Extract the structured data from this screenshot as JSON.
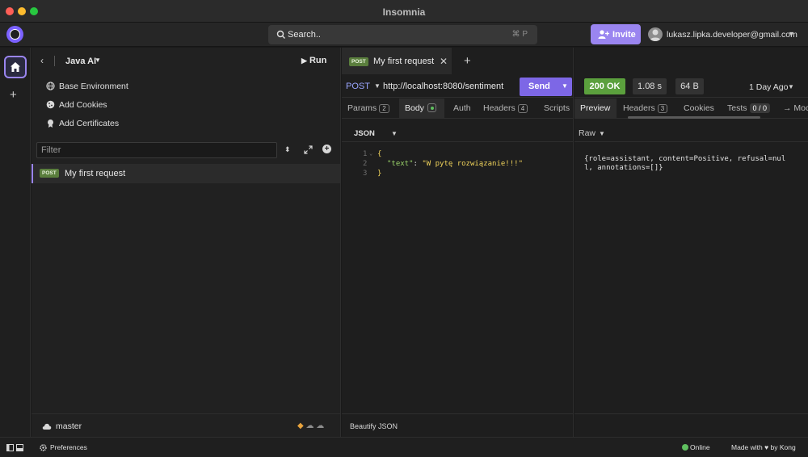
{
  "window": {
    "title": "Insomnia"
  },
  "topbar": {
    "search_label": "Search..",
    "search_shortcut": "⌘ P",
    "invite_label": "Invite",
    "account_email": "lukasz.lipka.developer@gmail.com"
  },
  "sidebar": {
    "project_name": "Java AI",
    "run_label": "Run",
    "items": [
      {
        "label": "Base Environment",
        "icon": "globe-icon"
      },
      {
        "label": "Add Cookies",
        "icon": "cookie-icon"
      },
      {
        "label": "Add Certificates",
        "icon": "certificate-icon"
      }
    ],
    "filter_placeholder": "Filter",
    "request": {
      "method": "POST",
      "name": "My first request"
    },
    "branch": "master"
  },
  "request": {
    "tab_method": "POST",
    "tab_name": "My first request",
    "method": "POST",
    "url": "http://localhost:8080/sentiment",
    "send_label": "Send",
    "tabs": [
      {
        "label": "Params",
        "count": "2"
      },
      {
        "label": "Body"
      },
      {
        "label": "Auth"
      },
      {
        "label": "Headers",
        "count": "4"
      },
      {
        "label": "Scripts"
      }
    ],
    "body_mode": "JSON",
    "code": {
      "line_numbers": [
        "1",
        "2",
        "3"
      ],
      "open": "{",
      "key": "\"text\"",
      "sep": ": ",
      "value": "\"W pytę rozwiązanie!!!\"",
      "close": "}"
    },
    "beautify_label": "Beautify JSON"
  },
  "response": {
    "status": "200 OK",
    "time": "1.08 s",
    "size": "64 B",
    "age": "1 Day Ago",
    "tabs": [
      {
        "label": "Preview"
      },
      {
        "label": "Headers",
        "count": "3"
      },
      {
        "label": "Cookies"
      },
      {
        "label": "Tests",
        "count": "0 / 0"
      },
      {
        "label": "→ Moc"
      }
    ],
    "mode": "Raw",
    "body": "{role=assistant, content=Positive, refusal=null, annotations=[]}"
  },
  "statusbar": {
    "preferences_label": "Preferences",
    "online_label": "Online",
    "made_with": "Made with ♥ by Kong"
  },
  "colors": {
    "accent": "#9a85f0",
    "send": "#7d67e6",
    "status_ok": "#5ba03d",
    "post_badge": "#5a7e3d"
  }
}
